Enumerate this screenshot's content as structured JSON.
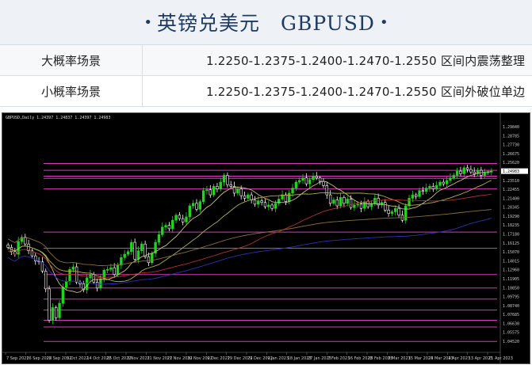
{
  "page": {
    "title": "英镑兑美元　GBPUSD",
    "title_dot": "•"
  },
  "scenarios": [
    {
      "label": "大概率场景",
      "value": "1.2250-1.2375-1.2400-1.2470-1.2550 区间内震荡整理"
    },
    {
      "label": "小概率场景",
      "value": "1.2250-1.2375-1.2400-1.2470-1.2550 区间外破位单边"
    }
  ],
  "colors": {
    "bull_candle": "#1fd51f",
    "bear_candle": "#ffffff",
    "hline": "#d63ab8",
    "ma_fast": "#c9c27a",
    "ma_mid": "#b0b04a",
    "ma_slow": "#b53030",
    "ma_long": "#2f2fb5",
    "ma_long2": "#8a6e3a"
  },
  "chart_data": {
    "type": "candlestick",
    "symbol_header": "GBPUSD,Daily  1.24397 1.24837 1.24397 1.24983",
    "price_range": [
      1.034,
      1.305
    ],
    "price_tag": "1.24983",
    "y_ticks": [
      "1.29840",
      "1.28785",
      "1.27730",
      "1.26675",
      "1.25620",
      "1.24565",
      "1.23510",
      "1.22455",
      "1.21400",
      "1.20345",
      "1.19290",
      "1.18235",
      "1.17180",
      "1.16125",
      "1.15070",
      "1.14015",
      "1.12960",
      "1.11905",
      "1.10850",
      "1.09795",
      "1.08740",
      "1.07685",
      "1.06630",
      "1.05575",
      "1.04520"
    ],
    "x_labels": [
      "7 Sep 2022",
      "16 Sep 2022",
      "28 Sep 2022",
      "5 Oct 2022",
      "14 Oct 2022",
      "25 Oct 2022",
      "3 Nov 2022",
      "11 Nov 2022",
      "21 Nov 2022",
      "30 Nov 2022",
      "9 Dec 2022",
      "19 Dec 2022",
      "29 Dec 2022",
      "9 Jan 2023",
      "18 Jan 2023",
      "27 Jan 2023",
      "7 Feb 2023",
      "16 Feb 2023",
      "28 Feb 2023",
      "9 Mar 2023",
      "15 Mar 2023",
      "24 Mar 2023",
      "4 Apr 2023",
      "13 Apr 2023",
      "21 Apr 2023"
    ],
    "horizontal_levels": [
      1.255,
      1.247,
      1.24,
      1.2375,
      1.225,
      1.174,
      1.155,
      1.124,
      1.108,
      1.095,
      1.082,
      1.07,
      1.062,
      1.045
    ],
    "closes": [
      1.156,
      1.151,
      1.148,
      1.163,
      1.168,
      1.16,
      1.152,
      1.146,
      1.14,
      1.139,
      1.128,
      1.107,
      1.07,
      1.085,
      1.073,
      1.09,
      1.109,
      1.116,
      1.13,
      1.133,
      1.115,
      1.113,
      1.106,
      1.12,
      1.124,
      1.115,
      1.108,
      1.119,
      1.129,
      1.13,
      1.132,
      1.124,
      1.135,
      1.144,
      1.148,
      1.151,
      1.162,
      1.142,
      1.152,
      1.16,
      1.145,
      1.138,
      1.149,
      1.162,
      1.171,
      1.18,
      1.182,
      1.178,
      1.188,
      1.194,
      1.19,
      1.186,
      1.192,
      1.205,
      1.208,
      1.201,
      1.21,
      1.223,
      1.224,
      1.218,
      1.228,
      1.225,
      1.233,
      1.241,
      1.23,
      1.228,
      1.22,
      1.225,
      1.217,
      1.214,
      1.218,
      1.212,
      1.207,
      1.211,
      1.209,
      1.204,
      1.206,
      1.202,
      1.208,
      1.213,
      1.218,
      1.21,
      1.22,
      1.226,
      1.233,
      1.235,
      1.238,
      1.231,
      1.236,
      1.24,
      1.238,
      1.234,
      1.229,
      1.218,
      1.208,
      1.212,
      1.205,
      1.215,
      1.208,
      1.213,
      1.203,
      1.206,
      1.207,
      1.202,
      1.21,
      1.204,
      1.208,
      1.214,
      1.206,
      1.209,
      1.2,
      1.196,
      1.198,
      1.202,
      1.194,
      1.188,
      1.205,
      1.214,
      1.218,
      1.216,
      1.223,
      1.222,
      1.226,
      1.228,
      1.225,
      1.229,
      1.233,
      1.231,
      1.235,
      1.238,
      1.241,
      1.246,
      1.243,
      1.25,
      1.248,
      1.245,
      1.243,
      1.247,
      1.241,
      1.244,
      1.245,
      1.246
    ]
  }
}
